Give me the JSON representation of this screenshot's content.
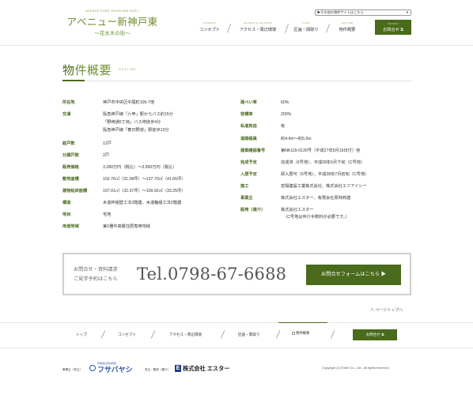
{
  "header": {
    "logo_sub": "AVENUE KOBE SHINKOBE EAST",
    "logo_main": "アベニュー新神戸東",
    "logo_tag": "〜花水木の街〜",
    "site_select": "▶その他の物件サイトはこちら",
    "nav": [
      {
        "en": "CONCEPT",
        "ja": "コンセプト"
      },
      {
        "en": "ACCESS & LOCATION",
        "ja": "アクセス・周辺環境"
      },
      {
        "en": "PLAN",
        "ja": "区画・間取り"
      },
      {
        "en": "OUTLINE",
        "ja": "物件概要"
      }
    ],
    "contact": {
      "en": "CONTACT",
      "ja": "お問合せ"
    }
  },
  "page": {
    "title_first": "物",
    "title_rest": "件概要",
    "title_en": "OUTLINE"
  },
  "spec_left": [
    {
      "label": "所在地",
      "lines": [
        "神戸市中央区中尾町105-7他"
      ]
    },
    {
      "label": "交通",
      "lines": [
        "阪急神戸線「六甲」駅からバス約15分",
        "「野崎通5丁目」バス停徒歩4分",
        "阪急神戸線「春日野道」駅徒歩13分"
      ]
    },
    {
      "label": "総戸数",
      "lines": [
        "12戸"
      ]
    },
    {
      "label": "分譲戸数",
      "lines": [
        "2戸"
      ]
    },
    {
      "label": "販売価格",
      "lines": [
        "3,280万円（税込）〜3,950万円（税込）"
      ]
    },
    {
      "label": "敷地面積",
      "lines": [
        "102.76㎡（31.08坪）〜137.70㎡（41.65坪）"
      ]
    },
    {
      "label": "建物延床面積",
      "lines": [
        "107.01㎡（32.37坪）〜109.92㎡（33.25坪）"
      ]
    },
    {
      "label": "構造",
      "lines": [
        "木造枠組壁工法2階建、木造軸組工法2階建"
      ]
    },
    {
      "label": "地目",
      "lines": [
        "宅地"
      ]
    },
    {
      "label": "用途地域",
      "lines": [
        "第1種中高層住居専用地域"
      ]
    }
  ],
  "spec_right": [
    {
      "label": "建ぺい率",
      "lines": [
        "60%"
      ]
    },
    {
      "label": "容積率",
      "lines": [
        "200%"
      ]
    },
    {
      "label": "私道負担",
      "lines": [
        "有"
      ]
    },
    {
      "label": "道路幅員",
      "lines": [
        "約4.4m〜約5.5m"
      ]
    },
    {
      "label": "建築確認番号",
      "lines": [
        "第NK115-0120号（平成27年5月15日付）他"
      ]
    },
    {
      "label": "完成予定",
      "lines": [
        "完成済（6号地）、平成28年6月下旬（C号地）"
      ]
    },
    {
      "label": "入居予定",
      "lines": [
        "即入居可（6号地）、平成28年7月初旬（C号地）"
      ]
    },
    {
      "label": "施工",
      "lines": [
        "宏陽建設工業株式会社、株式会社エフアイシー"
      ]
    },
    {
      "label": "事業主",
      "lines": [
        "株式会社エスター、有限会社原林商建"
      ]
    },
    {
      "label": "販売（媒介）",
      "lines": [
        "株式会社エスター",
        "（C号地は仲介手数料が必要です。）"
      ]
    }
  ],
  "contact_box": {
    "caption1": "お問合せ・資料請求",
    "caption2": "ご見学予約はこちら",
    "tel": "Tel.0798-67-6688",
    "form_button": "お問合せフォームはこちら ▶"
  },
  "page_top": "ページトップへ",
  "footer_nav": {
    "items": [
      "トップ",
      "コンセプト",
      "アクセス・周辺環境",
      "区画・間取り"
    ],
    "broken_image_alt": "物件概要",
    "contact": "お問合せ"
  },
  "credits": {
    "label1": "事業主（売主）",
    "brand1_top": "有限会社原林商建",
    "brand1_name": "フサバヤシ",
    "label2": "売主・販売（媒介）",
    "brand2_mark": "E",
    "brand2_name": "株式会社 エスター",
    "copyright": "Copyright (C) Ester Co., Ltd . All rights reserved."
  },
  "colors": {
    "accent": "#4a6b1b",
    "accent_light": "#6f8f2f",
    "border": "#cfcfcf"
  }
}
